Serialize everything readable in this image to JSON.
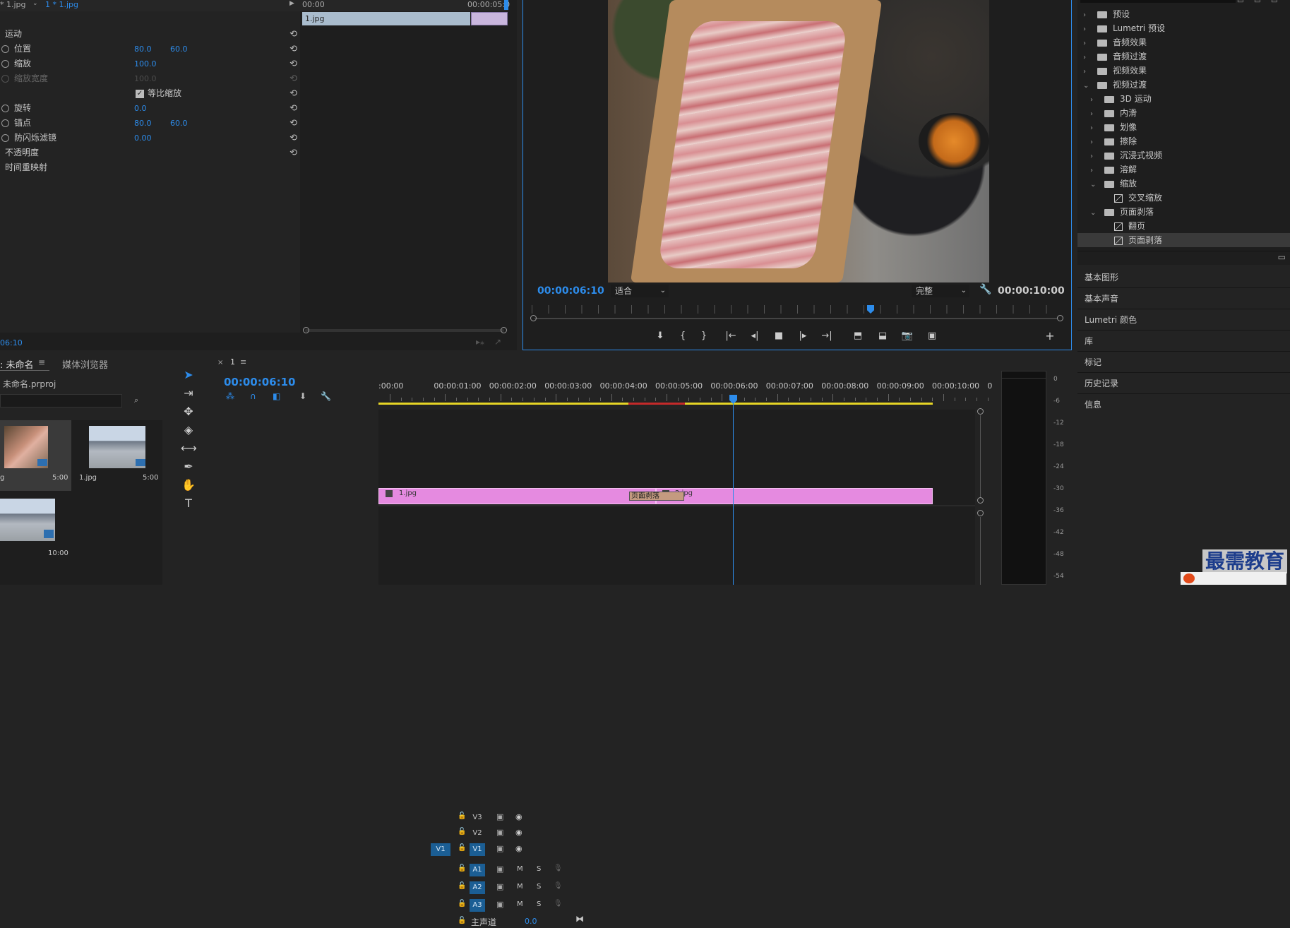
{
  "effect_controls": {
    "tabs": [
      "* 1.jpg",
      "1 * 1.jpg"
    ],
    "ruler": [
      "00:00",
      "00:00:05:0"
    ],
    "clip_label": "1.jpg",
    "motion": "运动",
    "rows": [
      {
        "label": "位置",
        "v1": "80.0",
        "v2": "60.0"
      },
      {
        "label": "缩放",
        "v1": "100.0",
        "v2": ""
      },
      {
        "label": "缩放宽度",
        "v1": "100.0",
        "v2": ""
      },
      {
        "label": "等比缩放",
        "v1": "",
        "v2": ""
      },
      {
        "label": "旋转",
        "v1": "0.0",
        "v2": ""
      },
      {
        "label": "锚点",
        "v1": "80.0",
        "v2": "60.0"
      },
      {
        "label": "防闪烁滤镜",
        "v1": "0.00",
        "v2": ""
      }
    ],
    "opacity": "不透明度",
    "time_remap": "时间重映射",
    "timecode": "06:10"
  },
  "program": {
    "timecode": "00:00:06:10",
    "fit": "适合",
    "quality": "完整",
    "duration": "00:00:10:00"
  },
  "effects": {
    "items": [
      {
        "label": "预设",
        "level": 0,
        "open": false
      },
      {
        "label": "Lumetri 预设",
        "level": 0,
        "open": false
      },
      {
        "label": "音频效果",
        "level": 0,
        "open": false
      },
      {
        "label": "音频过渡",
        "level": 0,
        "open": false
      },
      {
        "label": "视频效果",
        "level": 0,
        "open": false
      },
      {
        "label": "视频过渡",
        "level": 0,
        "open": true
      },
      {
        "label": "3D 运动",
        "level": 1,
        "open": false
      },
      {
        "label": "内滑",
        "level": 1,
        "open": false
      },
      {
        "label": "划像",
        "level": 1,
        "open": false
      },
      {
        "label": "擦除",
        "level": 1,
        "open": false
      },
      {
        "label": "沉浸式视频",
        "level": 1,
        "open": false
      },
      {
        "label": "溶解",
        "level": 1,
        "open": false
      },
      {
        "label": "缩放",
        "level": 1,
        "open": true
      },
      {
        "label": "交叉缩放",
        "level": 2,
        "open": false
      },
      {
        "label": "页面剥落",
        "level": 1,
        "open": true
      },
      {
        "label": "翻页",
        "level": 2,
        "open": false
      },
      {
        "label": "页面剥落",
        "level": 2,
        "open": false
      }
    ],
    "sections": [
      "基本图形",
      "基本声音",
      "Lumetri 颜色",
      "库",
      "标记",
      "历史记录",
      "信息"
    ]
  },
  "project": {
    "tabs": [
      "未命名",
      "媒体浏览器"
    ],
    "file": "未命名.prproj",
    "thumbs": [
      {
        "label": "g",
        "dur": "5:00"
      },
      {
        "label": "1.jpg",
        "dur": "5:00"
      },
      {
        "label": "",
        "dur": "10:00"
      }
    ]
  },
  "timeline": {
    "tab": "1",
    "timecode": "00:00:06:10",
    "ruler": [
      ":00:00",
      "00:00:01:00",
      "00:00:02:00",
      "00:00:03:00",
      "00:00:04:00",
      "00:00:05:00",
      "00:00:06:00",
      "00:00:07:00",
      "00:00:08:00",
      "00:00:09:00",
      "00:00:10:00",
      "0"
    ],
    "video_tracks": [
      "V3",
      "V2",
      "V1"
    ],
    "audio_tracks": [
      "A1",
      "A2",
      "A3"
    ],
    "source_patch": "V1",
    "mute": "M",
    "solo": "S",
    "master": "主声道",
    "master_val": "0.0",
    "clips": [
      {
        "label": "1.jpg"
      },
      {
        "label": "2.jpg"
      }
    ],
    "transition": "页面剥落"
  },
  "meter": {
    "scale": [
      "0",
      "-6",
      "-12",
      "-18",
      "-24",
      "-30",
      "-36",
      "-42",
      "-48",
      "-54"
    ]
  },
  "watermark": "最需教育"
}
